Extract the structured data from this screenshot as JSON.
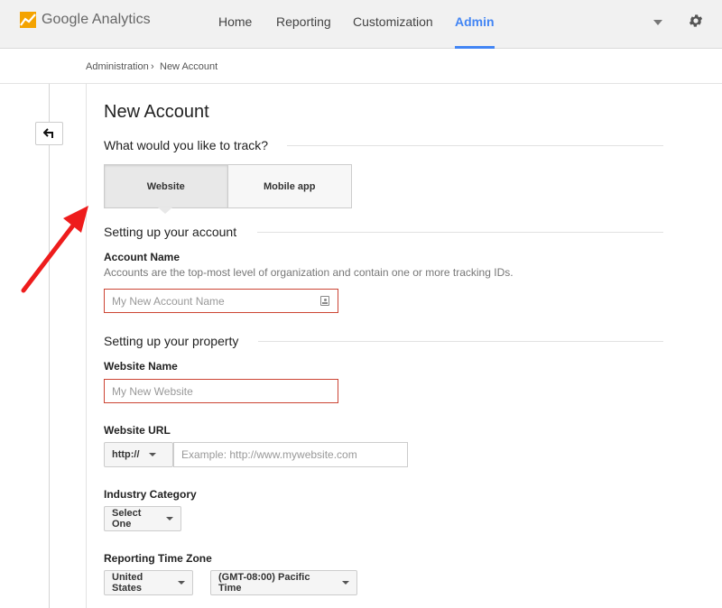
{
  "header": {
    "app_name": "Google Analytics",
    "nav": [
      {
        "label": "Home"
      },
      {
        "label": "Reporting"
      },
      {
        "label": "Customization"
      },
      {
        "label": "Admin"
      }
    ],
    "active_nav": "Admin",
    "colors": {
      "accent": "#4285f4",
      "logo_orange": "#f4a300",
      "logo_red": "#e8710a"
    }
  },
  "breadcrumb": {
    "items": [
      {
        "label": "Administration"
      },
      {
        "label": "New Account"
      }
    ],
    "separator": "›"
  },
  "page": {
    "title": "New Account",
    "track_heading": "What would you like to track?",
    "track_options": [
      {
        "label": "Website",
        "selected": true
      },
      {
        "label": "Mobile app",
        "selected": false
      }
    ],
    "account_section": {
      "heading": "Setting up your account",
      "account_name_label": "Account Name",
      "account_name_help": "Accounts are the top-most level of organization and contain one or more tracking IDs.",
      "account_name_value": "",
      "account_name_placeholder": "My New Account Name"
    },
    "property_section": {
      "heading": "Setting up your property",
      "website_name_label": "Website Name",
      "website_name_value": "",
      "website_name_placeholder": "My New Website",
      "website_url_label": "Website URL",
      "protocol_selected": "http://",
      "website_url_value": "",
      "website_url_placeholder": "Example: http://www.mywebsite.com",
      "industry_label": "Industry Category",
      "industry_selected": "Select One",
      "timezone_label": "Reporting Time Zone",
      "timezone_country_selected": "United States",
      "timezone_selected": "(GMT-08:00) Pacific Time"
    }
  },
  "annotation": {
    "arrow_color": "#ee1c1c"
  },
  "icons": {
    "logo": "analytics-logo-icon",
    "account_caret": "chevron-down-icon",
    "settings": "gear-icon",
    "back": "back-arrow-icon",
    "contact": "contact-card-icon"
  }
}
